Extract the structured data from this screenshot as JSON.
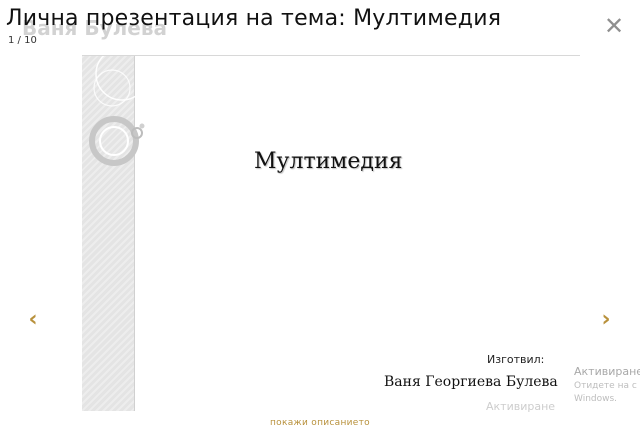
{
  "header": {
    "title": "Лична презентация на тема: Мултимедия",
    "ghost_title": "Ваня Булева",
    "counter": "1 / 10"
  },
  "icons": {
    "close": "close-icon",
    "prev": "chevron-left-icon",
    "next": "chevron-right-icon"
  },
  "controls": {
    "close_glyph": "✕",
    "prev_glyph": "‹",
    "next_glyph": "›"
  },
  "slide": {
    "title": "Мултимедия",
    "made_by_label": "Изготвил:",
    "author": "Ваня Георгиева Булева"
  },
  "watermark": {
    "line1": "Активиране",
    "line2": "Отидете на с",
    "line3": "Windows.",
    "line4": "Активиране"
  },
  "footer": {
    "show_description": "покажи описанието"
  },
  "colors": {
    "accent": "#b8913c",
    "title": "#111111",
    "close": "#8f8f8f"
  }
}
